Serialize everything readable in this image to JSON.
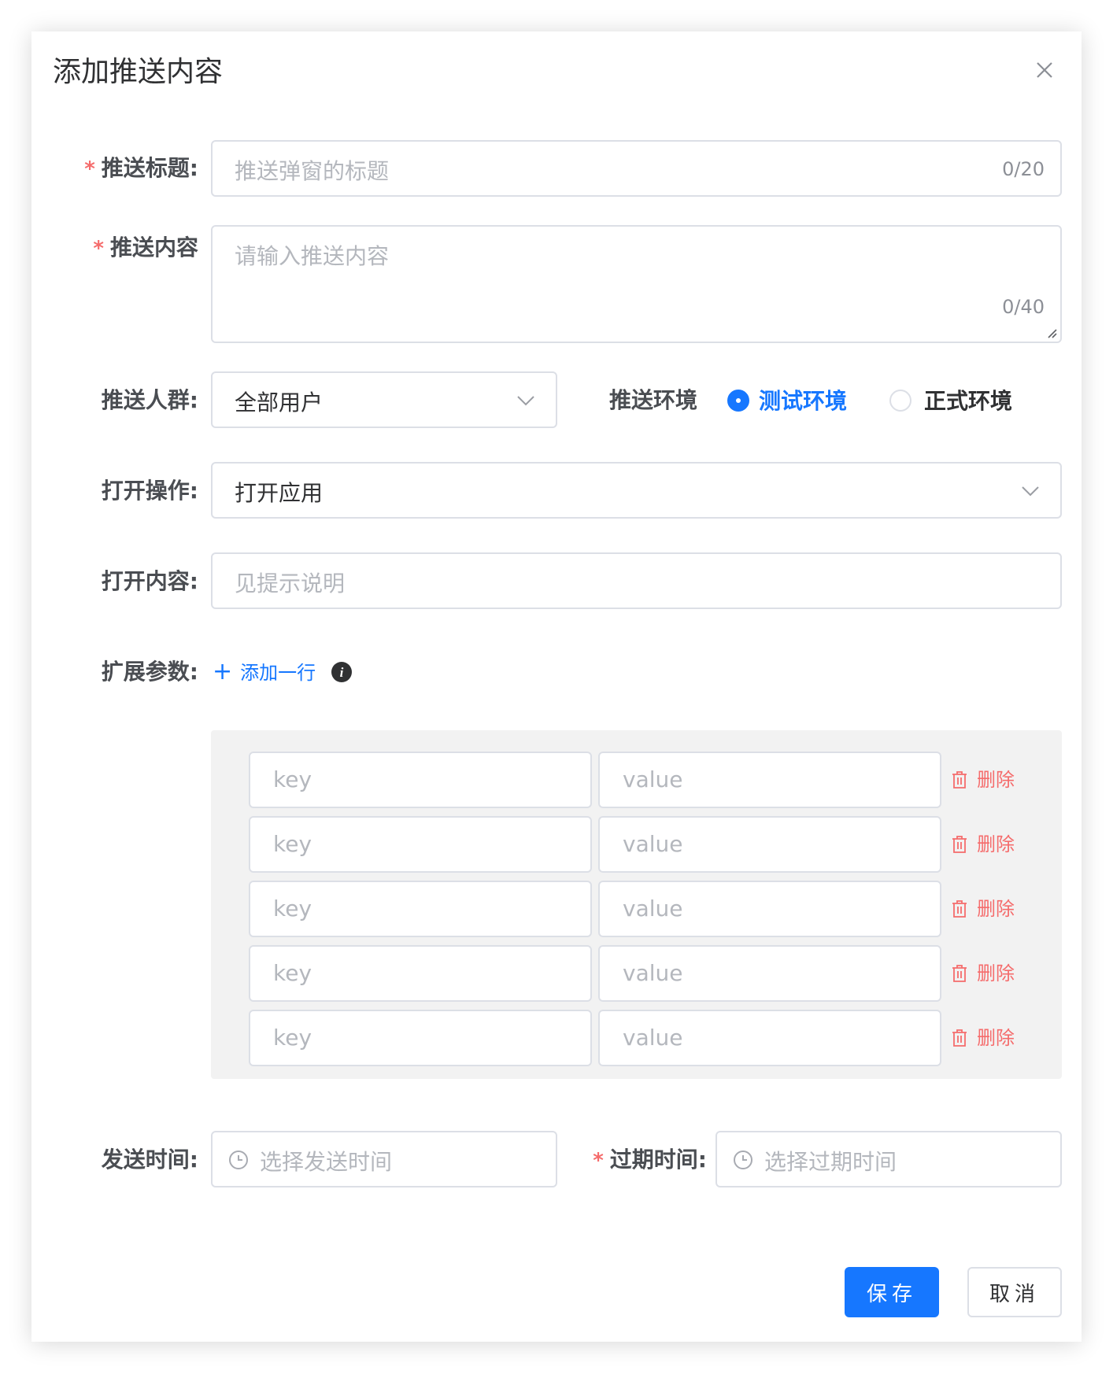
{
  "dialog": {
    "title": "添加推送内容",
    "close_icon": "close-icon"
  },
  "form": {
    "title": {
      "label": "推送标题:",
      "required_mark": "*",
      "placeholder": "推送弹窗的标题",
      "counter": "0/20"
    },
    "content": {
      "label": "推送内容",
      "required_mark": "*",
      "placeholder": "请输入推送内容",
      "counter": "0/40"
    },
    "audience": {
      "label": "推送人群:",
      "value": "全部用户"
    },
    "environment": {
      "label": "推送环境",
      "options": [
        {
          "label": "测试环境",
          "checked": true
        },
        {
          "label": "正式环境",
          "checked": false
        }
      ]
    },
    "open_action": {
      "label": "打开操作:",
      "value": "打开应用"
    },
    "open_content": {
      "label": "打开内容:",
      "placeholder": "见提示说明"
    },
    "ext_params": {
      "label": "扩展参数:",
      "add_row": "添加一行",
      "add_icon": "+",
      "key_placeholder": "key",
      "value_placeholder": "value",
      "delete_label": "删除",
      "rows": 5
    },
    "send_time": {
      "label": "发送时间:",
      "placeholder": "选择发送时间"
    },
    "expire_time": {
      "label": "过期时间:",
      "required_mark": "*",
      "placeholder": "选择过期时间"
    }
  },
  "footer": {
    "save_label": "保存",
    "cancel_label": "取消"
  },
  "colors": {
    "primary": "#1677ff",
    "danger": "#f56c6c",
    "border": "#dcdfe6",
    "placeholder": "#b4b7bd"
  }
}
